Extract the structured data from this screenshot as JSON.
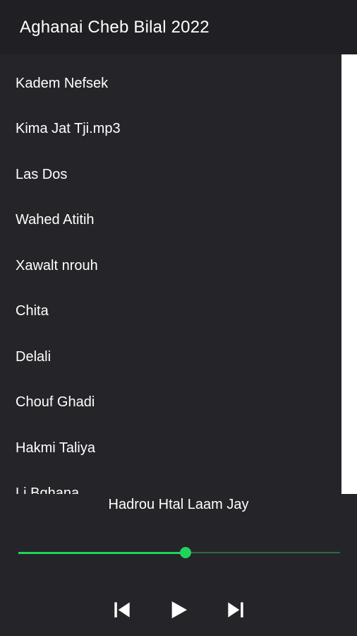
{
  "app_bar": {
    "title": "Aghanai Cheb Bilal 2022"
  },
  "songs": [
    "Kadem Nefsek",
    "Kima Jat Tji.mp3",
    "Las Dos",
    "Wahed Atitih",
    "Xawalt nrouh",
    "Chita",
    "Delali",
    "Chouf Ghadi",
    "Hakmi Taliya",
    "Li Bghana"
  ],
  "player": {
    "now_playing": "Hadrou Htal Laam Jay",
    "progress": 0.52,
    "controls": {
      "previous_icon": "skip-previous-icon",
      "play_icon": "play-icon",
      "next_icon": "skip-next-icon"
    }
  },
  "colors": {
    "background": "#252529",
    "app_bar": "#202024",
    "accent": "#1fd35c",
    "text": "#ffffff"
  }
}
